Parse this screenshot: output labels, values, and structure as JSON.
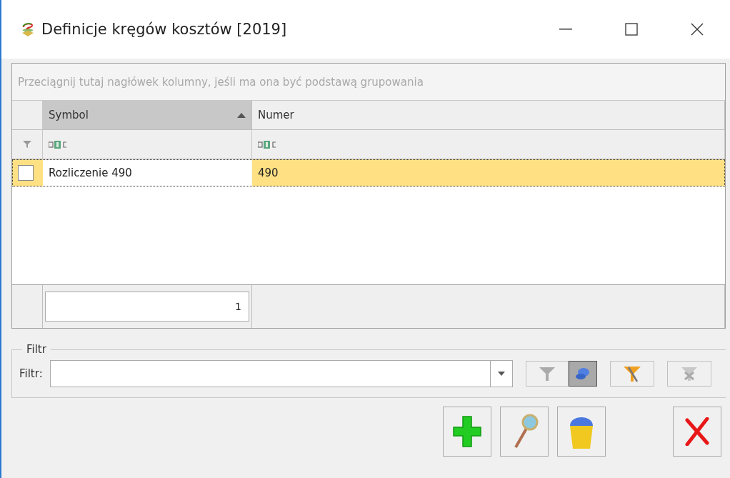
{
  "window": {
    "title": "Definicje kręgów kosztów [2019]"
  },
  "grid": {
    "group_hint": "Przeciągnij tutaj nagłówek kolumny, jeśli ma ona być podstawą grupowania",
    "columns": [
      {
        "label": "Symbol",
        "sorted": true
      },
      {
        "label": "Numer",
        "sorted": false
      }
    ],
    "rows": [
      {
        "checked": false,
        "selected": true,
        "cells": [
          "Rozliczenie 490",
          "490"
        ]
      }
    ],
    "footer": {
      "count": "1"
    }
  },
  "filter": {
    "group_title": "Filtr",
    "label": "Filtr:",
    "pinned": true
  }
}
